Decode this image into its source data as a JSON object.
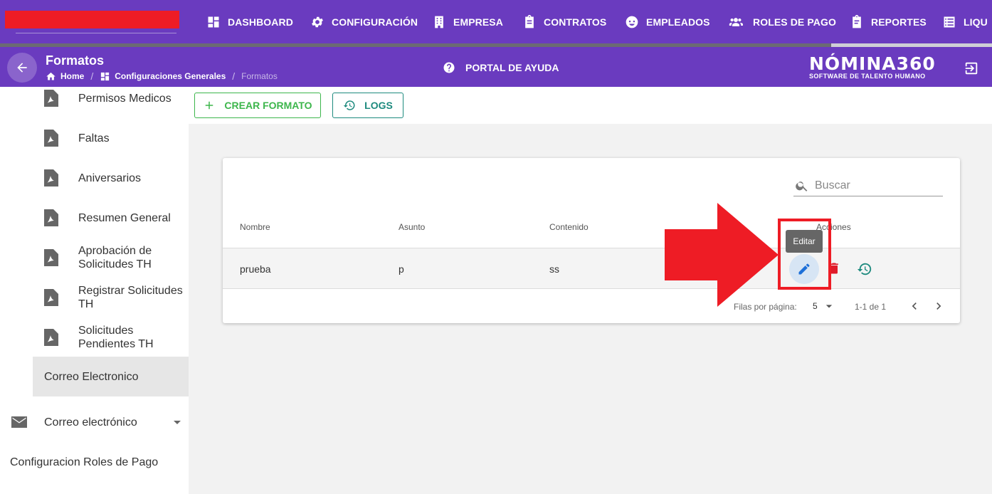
{
  "topnav": {
    "items": [
      {
        "label": "DASHBOARD",
        "icon": "dashboard-icon"
      },
      {
        "label": "CONFIGURACIÓN",
        "icon": "gear-icon"
      },
      {
        "label": "EMPRESA",
        "icon": "building-icon"
      },
      {
        "label": "CONTRATOS",
        "icon": "clipboard-icon"
      },
      {
        "label": "EMPLEADOS",
        "icon": "face-icon"
      },
      {
        "label": "ROLES DE PAGO",
        "icon": "people-icon"
      },
      {
        "label": "REPORTES",
        "icon": "report-icon"
      },
      {
        "label": "LIQU",
        "icon": "list-icon"
      }
    ]
  },
  "header": {
    "title": "Formatos",
    "breadcrumb": [
      "Home",
      "Configuraciones Generales",
      "Formatos"
    ],
    "portal_label": "PORTAL DE AYUDA",
    "logo_main": "NÓMINA360",
    "logo_sub": "SOFTWARE DE TALENTO HUMANO"
  },
  "sidebar": {
    "items": [
      {
        "label": "Permisos Medicos"
      },
      {
        "label": "Faltas"
      },
      {
        "label": "Aniversarios"
      },
      {
        "label": "Resumen General"
      },
      {
        "label_l1": "Aprobación de",
        "label_l2": "Solicitudes TH"
      },
      {
        "label_l1": "Registrar Solicitudes",
        "label_l2": "TH"
      },
      {
        "label_l1": "Solicitudes",
        "label_l2": "Pendientes TH"
      },
      {
        "label": "Correo Electronico"
      }
    ],
    "group_mail": "Correo electrónico",
    "group_roles": "Configuracion Roles de Pago"
  },
  "toolbar": {
    "create_label": "CREAR FORMATO",
    "logs_label": "LOGS"
  },
  "table": {
    "search_placeholder": "Buscar",
    "columns": [
      "Nombre",
      "Asunto",
      "Contenido",
      "Acciones"
    ],
    "rows": [
      {
        "nombre": "prueba",
        "asunto": "p",
        "contenido": "ss"
      }
    ],
    "tooltip": "Editar",
    "rows_per_page_label": "Filas por página:",
    "rows_per_page": "5",
    "range": "1-1 de 1"
  },
  "colors": {
    "brand_purple": "#6a3bbf",
    "annotation_red": "#ee1c25",
    "create_green": "#3db64c",
    "logs_teal": "#1d8a7e"
  }
}
